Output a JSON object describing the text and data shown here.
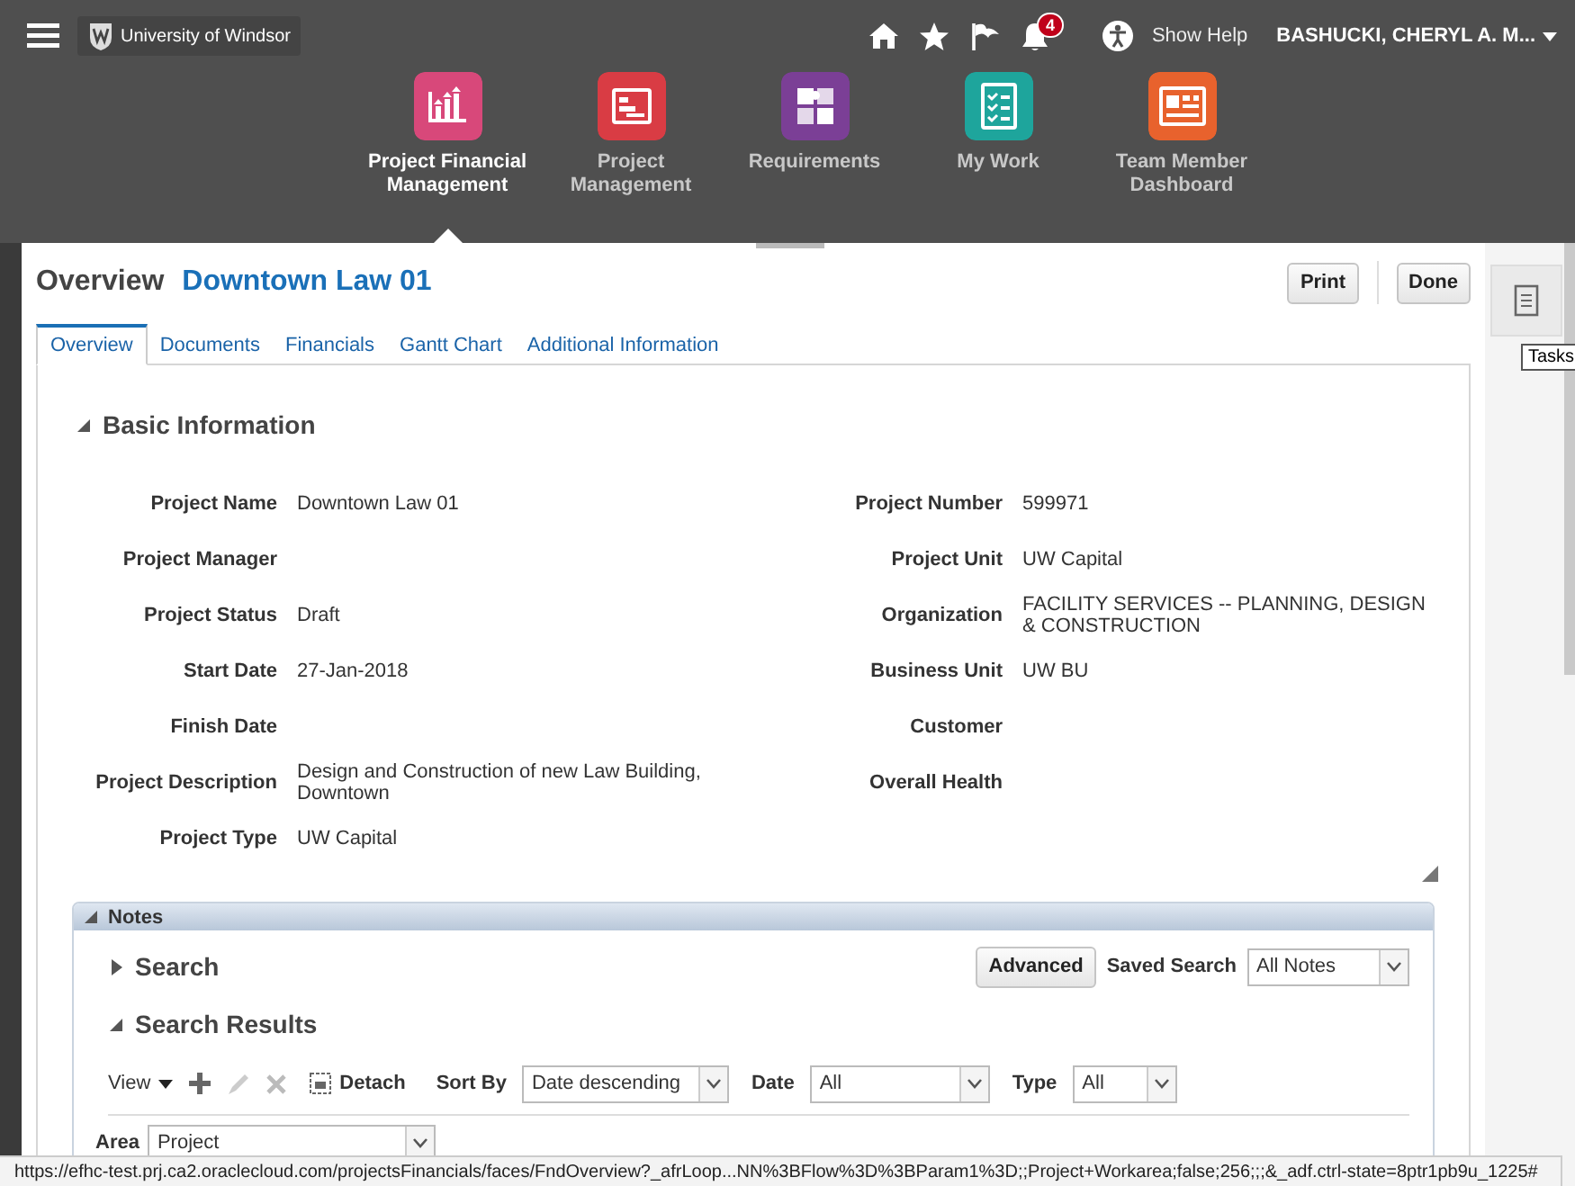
{
  "header": {
    "logo_text": "University of Windsor",
    "notification_count": "4",
    "show_help": "Show Help",
    "user": "BASHUCKI, CHERYL A. M..."
  },
  "apps": [
    {
      "label": "Project Financial Management",
      "kind": "chart",
      "color": "#d8487a",
      "selected": true
    },
    {
      "label": "Project Management",
      "kind": "gantt",
      "color": "#d93c44",
      "selected": false
    },
    {
      "label": "Requirements",
      "kind": "puzzle",
      "color": "#7b3f96",
      "selected": false
    },
    {
      "label": "My Work",
      "kind": "checklist",
      "color": "#1ea59c",
      "selected": false
    },
    {
      "label": "Team Member Dashboard",
      "kind": "dashboard",
      "color": "#e8622d",
      "selected": false
    }
  ],
  "page": {
    "title": "Overview",
    "project": "Downtown Law 01",
    "buttons": [
      "Print",
      "Done"
    ]
  },
  "tabs": [
    {
      "label": "Overview",
      "selected": true
    },
    {
      "label": "Documents",
      "selected": false
    },
    {
      "label": "Financials",
      "selected": false
    },
    {
      "label": "Gantt Chart",
      "selected": false
    },
    {
      "label": "Additional Information",
      "selected": false
    }
  ],
  "basic_information": {
    "title": "Basic Information",
    "expanded": true,
    "left": [
      {
        "label": "Project Name",
        "value": "Downtown Law 01"
      },
      {
        "label": "Project Manager"
      },
      {
        "label": "Project Status",
        "value": "Draft"
      },
      {
        "label": "Start Date",
        "value": "27-Jan-2018"
      },
      {
        "label": "Finish Date"
      },
      {
        "label": "Project Description",
        "value": "Design and Construction of new Law Building, Downtown"
      },
      {
        "label": "Project Type",
        "value": "UW Capital"
      }
    ],
    "right": [
      {
        "label": "Project Number",
        "value": "599971"
      },
      {
        "label": "Project Unit",
        "value": "UW Capital"
      },
      {
        "label": "Organization",
        "value": "FACILITY SERVICES -- PLANNING, DESIGN & CONSTRUCTION"
      },
      {
        "label": "Business Unit",
        "value": "UW BU"
      },
      {
        "label": "Customer"
      },
      {
        "label": "Overall Health"
      }
    ]
  },
  "notes": {
    "title": "Notes",
    "expanded": true,
    "search": {
      "title": "Search",
      "expanded": false,
      "advanced": "Advanced",
      "saved_search_label": "Saved Search",
      "saved_search": "All Notes"
    },
    "results": {
      "title": "Search Results",
      "expanded": true,
      "view": "View",
      "detach": "Detach",
      "sort_by_label": "Sort By",
      "sort_by": "Date descending",
      "date_label": "Date",
      "date": "All",
      "type_label": "Type",
      "type": "All",
      "area_label": "Area",
      "area": "Project"
    }
  },
  "tasks": {
    "tooltip": "Tasks"
  },
  "status_bar": "https://efhc-test.prj.ca2.oraclecloud.com/projectsFinancials/faces/FndOverview?_afrLoop...NN%3BFlow%3D%3BParam1%3D;;Project+Workarea;false;256;;;&_adf.ctrl-state=8ptr1pb9u_1225#"
}
